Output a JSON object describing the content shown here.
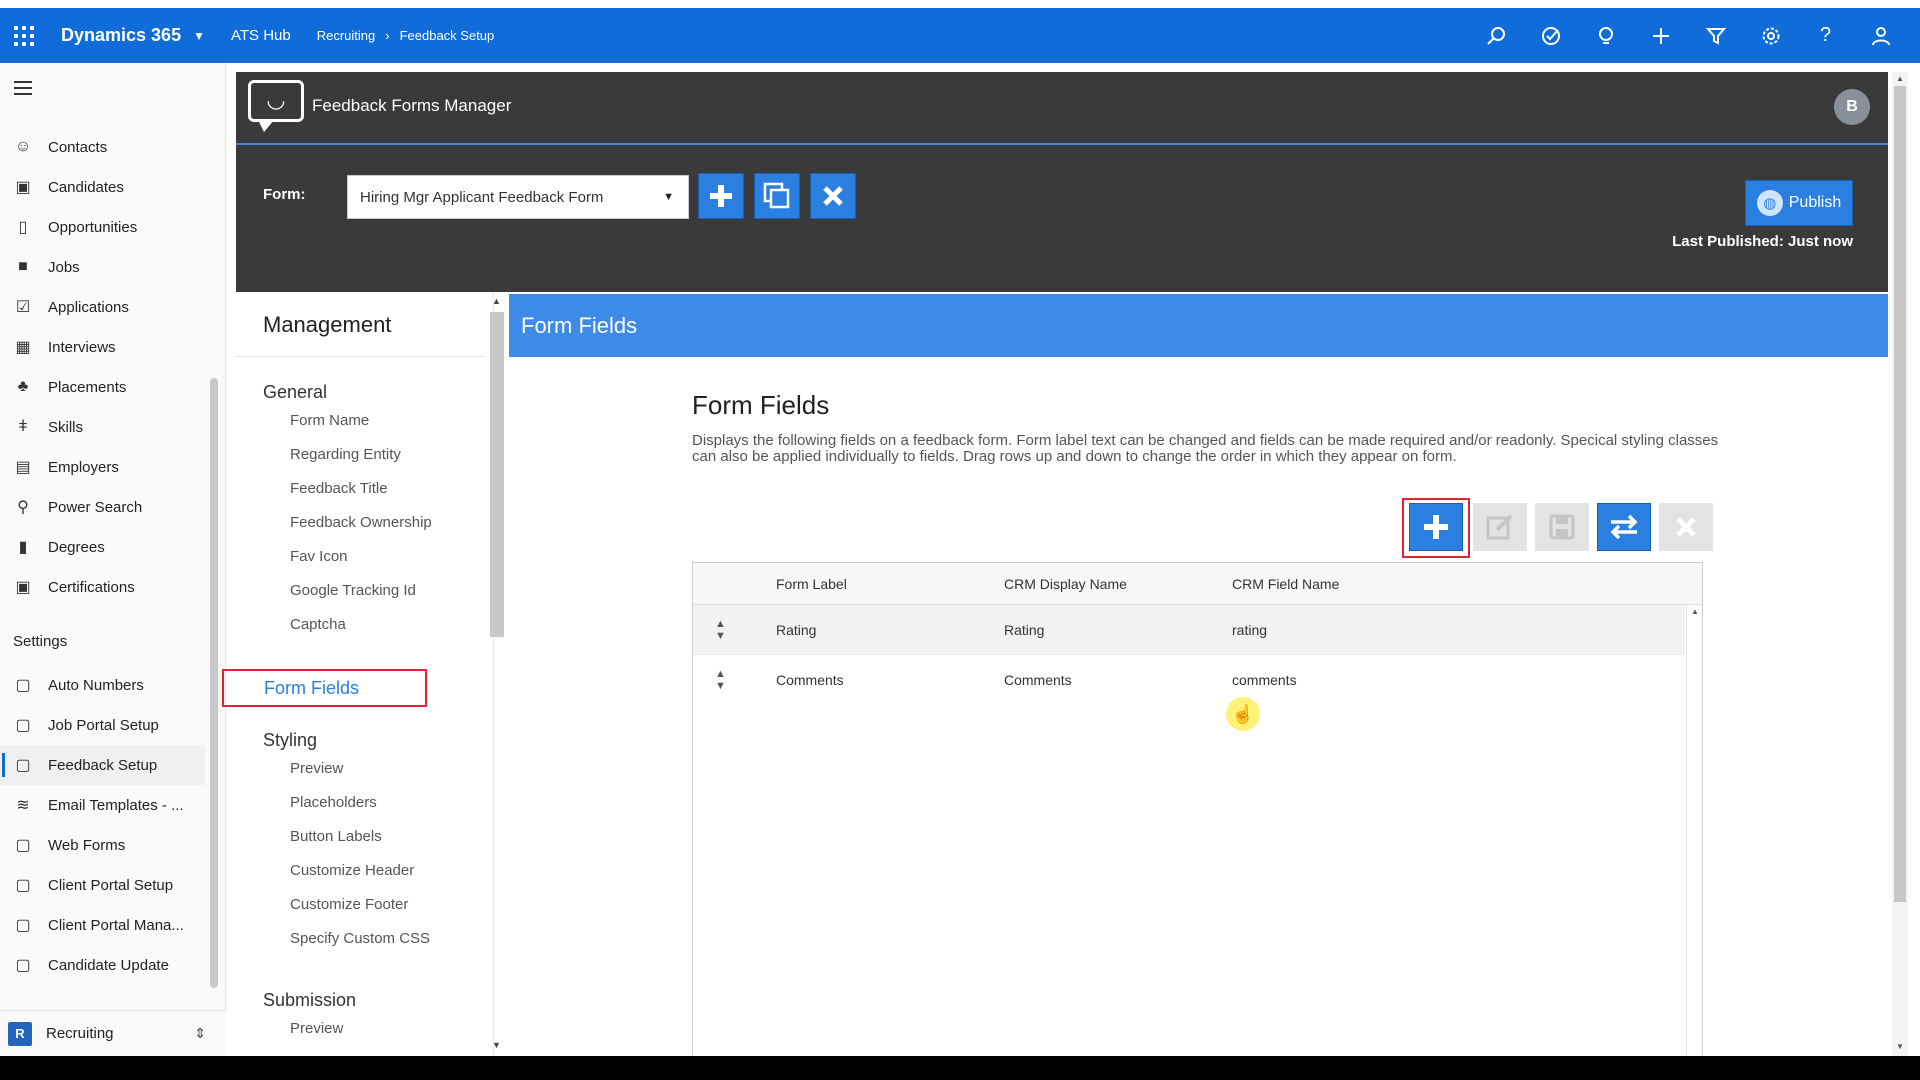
{
  "topbar": {
    "brand": "Dynamics 365",
    "app": "ATS Hub",
    "breadcrumb": [
      "Recruiting",
      "Feedback Setup"
    ],
    "icons": [
      "search-icon",
      "task-icon",
      "lightbulb-icon",
      "plus-icon",
      "filter-icon",
      "gear-icon",
      "help-icon",
      "user-icon"
    ]
  },
  "leftnav": {
    "items": [
      {
        "label": "Contacts",
        "icon": "person-icon"
      },
      {
        "label": "Candidates",
        "icon": "id-card-icon"
      },
      {
        "label": "Opportunities",
        "icon": "document-alert-icon"
      },
      {
        "label": "Jobs",
        "icon": "briefcase-icon"
      },
      {
        "label": "Applications",
        "icon": "checkbox-icon"
      },
      {
        "label": "Interviews",
        "icon": "calendar-icon"
      },
      {
        "label": "Placements",
        "icon": "people-icon"
      },
      {
        "label": "Skills",
        "icon": "tools-icon"
      },
      {
        "label": "Employers",
        "icon": "building-icon"
      },
      {
        "label": "Power Search",
        "icon": "search-icon"
      },
      {
        "label": "Degrees",
        "icon": "book-icon"
      },
      {
        "label": "Certifications",
        "icon": "certificate-icon"
      }
    ],
    "settings_header": "Settings",
    "settings_items": [
      {
        "label": "Auto Numbers",
        "icon": "clipboard-icon"
      },
      {
        "label": "Job Portal Setup",
        "icon": "clipboard-icon"
      },
      {
        "label": "Feedback Setup",
        "icon": "clipboard-icon",
        "active": true
      },
      {
        "label": "Email Templates - ...",
        "icon": "layers-icon"
      },
      {
        "label": "Web Forms",
        "icon": "clipboard-icon"
      },
      {
        "label": "Client Portal Setup",
        "icon": "clipboard-icon"
      },
      {
        "label": "Client Portal Mana...",
        "icon": "clipboard-icon"
      },
      {
        "label": "Candidate Update",
        "icon": "clipboard-icon"
      }
    ],
    "area": {
      "badge": "R",
      "label": "Recruiting"
    }
  },
  "header": {
    "title": "Feedback Forms Manager",
    "avatar": "B",
    "form_label": "Form:",
    "form_selected": "Hiring Mgr Applicant Feedback Form",
    "publish_label": "Publish",
    "last_published": "Last Published: Just now"
  },
  "management": {
    "title": "Management",
    "groups": [
      {
        "label": "General",
        "items": [
          "Form Name",
          "Regarding Entity",
          "Feedback Title",
          "Feedback Ownership",
          "Fav Icon",
          "Google Tracking Id",
          "Captcha"
        ]
      },
      {
        "label": "Form Fields",
        "items": [],
        "active": true
      },
      {
        "label": "Styling",
        "items": [
          "Preview",
          "Placeholders",
          "Button Labels",
          "Customize Header",
          "Customize Footer",
          "Specify Custom CSS"
        ]
      },
      {
        "label": "Submission",
        "items": [
          "Preview"
        ]
      }
    ]
  },
  "panel": {
    "header": "Form Fields",
    "title": "Form Fields",
    "description": "Displays the following fields on a feedback form. Form label text can be changed and fields can be made required and/or readonly. Specical styling classes can also be applied individually to fields. Drag rows up and down to change the order in which they appear on form.",
    "columns": [
      "Form Label",
      "CRM Display Name",
      "CRM Field Name"
    ],
    "rows": [
      [
        "Rating",
        "Rating",
        "rating"
      ],
      [
        "Comments",
        "Comments",
        "comments"
      ]
    ]
  },
  "colors": {
    "topbar": "#0f6cd9",
    "header_bg": "#3a3a3a",
    "accent": "#2a7fe0",
    "panel_header": "#3d8ae8",
    "highlight_red": "#e0232f"
  }
}
